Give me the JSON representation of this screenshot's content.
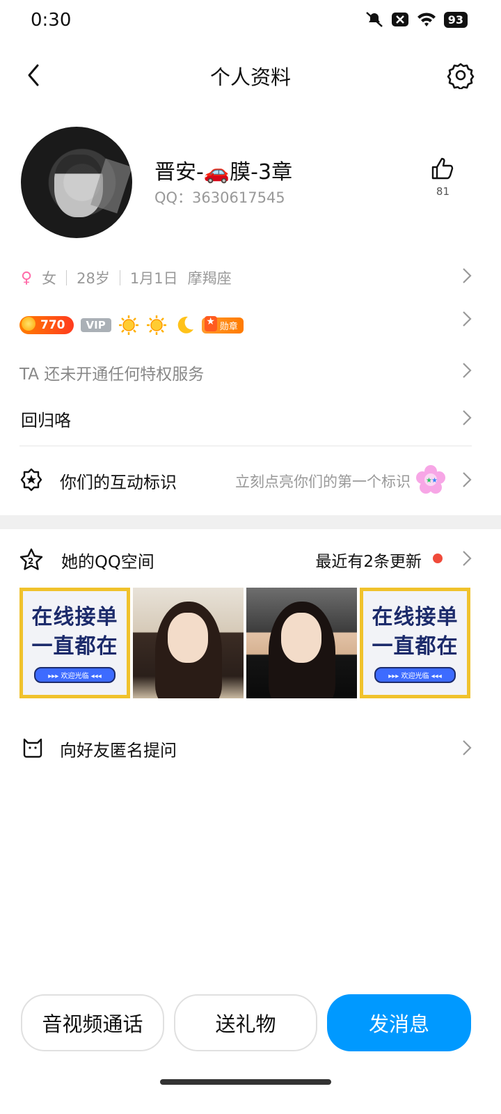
{
  "status": {
    "time": "0:30",
    "battery": "93"
  },
  "header": {
    "title": "个人资料"
  },
  "profile": {
    "nickname": "晋安-🚗膜-3章",
    "qq": "QQ：3630617545",
    "likes": "81",
    "gender_symbol": "♀",
    "gender": "女",
    "age": "28岁",
    "birthday": "1月1日",
    "zodiac": "摩羯座"
  },
  "badges": {
    "level": "770",
    "vip": "VIP",
    "medal": "勋章"
  },
  "privilege_text": "TA 还未开通任何特权服务",
  "signature": "回归咯",
  "interaction": {
    "label": "你们的互动标识",
    "hint": "立刻点亮你们的第一个标识"
  },
  "qzone": {
    "label": "她的QQ空间",
    "update": "最近有2条更新",
    "ad_line1": "在线接单",
    "ad_line2": "一直都在",
    "ad_pill": "▸▸▸ 欢迎光临 ◂◂◂"
  },
  "ask": {
    "label": "向好友匿名提问"
  },
  "buttons": {
    "call": "音视频通话",
    "gift": "送礼物",
    "message": "发消息"
  },
  "colors": {
    "accent": "#0099ff",
    "dot": "#f04a3a"
  }
}
